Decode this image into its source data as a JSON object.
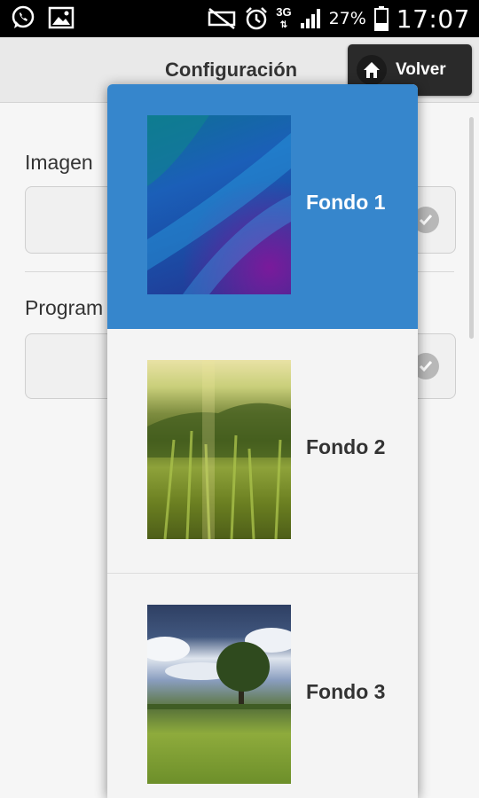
{
  "status_bar": {
    "network": "3G",
    "battery": "27%",
    "time": "17:07",
    "icons": [
      "whatsapp-icon",
      "gallery-icon",
      "mute-icon",
      "alarm-icon",
      "signal-icon",
      "battery-icon"
    ]
  },
  "header": {
    "title": "Configuración",
    "back_label": "Volver",
    "back_icon": "home-icon"
  },
  "form": {
    "field1_label": "Imagen",
    "field2_label": "Program"
  },
  "dropdown": {
    "options": [
      {
        "label": "Fondo 1",
        "selected": true
      },
      {
        "label": "Fondo 2",
        "selected": false
      },
      {
        "label": "Fondo 3",
        "selected": false
      }
    ]
  },
  "colors": {
    "selected": "#3686cc",
    "header_bg": "#e9e9e9",
    "button_bg": "#2a2a2a"
  }
}
